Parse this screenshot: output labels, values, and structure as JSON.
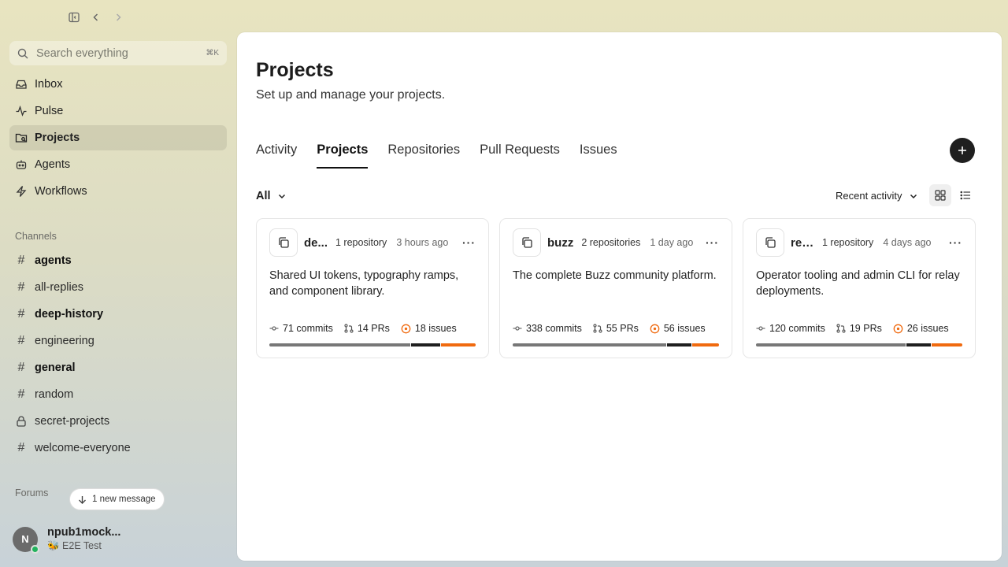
{
  "sidebar": {
    "search": {
      "placeholder": "Search everything",
      "shortcut": "⌘K"
    },
    "nav": [
      {
        "label": "Inbox",
        "icon": "inbox-icon"
      },
      {
        "label": "Pulse",
        "icon": "pulse-icon"
      },
      {
        "label": "Projects",
        "icon": "projects-icon",
        "active": true
      },
      {
        "label": "Agents",
        "icon": "robot-icon"
      },
      {
        "label": "Workflows",
        "icon": "lightning-icon"
      }
    ],
    "channels_label": "Channels",
    "channels": [
      {
        "name": "agents",
        "bold": true
      },
      {
        "name": "all-replies",
        "bold": false
      },
      {
        "name": "deep-history",
        "bold": true
      },
      {
        "name": "engineering",
        "bold": false
      },
      {
        "name": "general",
        "bold": true
      },
      {
        "name": "random",
        "bold": false
      },
      {
        "name": "secret-projects",
        "bold": false,
        "locked": true
      },
      {
        "name": "welcome-everyone",
        "bold": false
      }
    ],
    "forums_label": "Forums",
    "new_message": "1 new message",
    "user": {
      "initial": "N",
      "name": "npub1mock...",
      "status": "🐝 E2E Test"
    }
  },
  "main": {
    "title": "Projects",
    "subtitle": "Set up and manage your projects.",
    "tabs": [
      {
        "label": "Activity",
        "active": false
      },
      {
        "label": "Projects",
        "active": true
      },
      {
        "label": "Repositories",
        "active": false
      },
      {
        "label": "Pull Requests",
        "active": false
      },
      {
        "label": "Issues",
        "active": false
      }
    ],
    "filter": "All",
    "sort": "Recent activity",
    "projects": [
      {
        "name": "de...",
        "repos": "1 repository",
        "time": "3 hours ago",
        "description": "Shared UI tokens, typography ramps, and component library.",
        "commits": "71 commits",
        "prs": "14 PRs",
        "issues": "18 issues",
        "bar": [
          0.69,
          0.14,
          0.17
        ]
      },
      {
        "name": "buzz",
        "repos": "2 repositories",
        "time": "1 day ago",
        "description": "The complete Buzz community platform.",
        "commits": "338 commits",
        "prs": "55 PRs",
        "issues": "56 issues",
        "bar": [
          0.75,
          0.12,
          0.13
        ]
      },
      {
        "name": "rel...",
        "repos": "1 repository",
        "time": "4 days ago",
        "description": "Operator tooling and admin CLI for relay deployments.",
        "commits": "120 commits",
        "prs": "19 PRs",
        "issues": "26 issues",
        "bar": [
          0.73,
          0.12,
          0.15
        ]
      }
    ]
  },
  "colors": {
    "accent": "#f06a0f",
    "dark": "#1f1f1f",
    "online": "#22b35e"
  }
}
